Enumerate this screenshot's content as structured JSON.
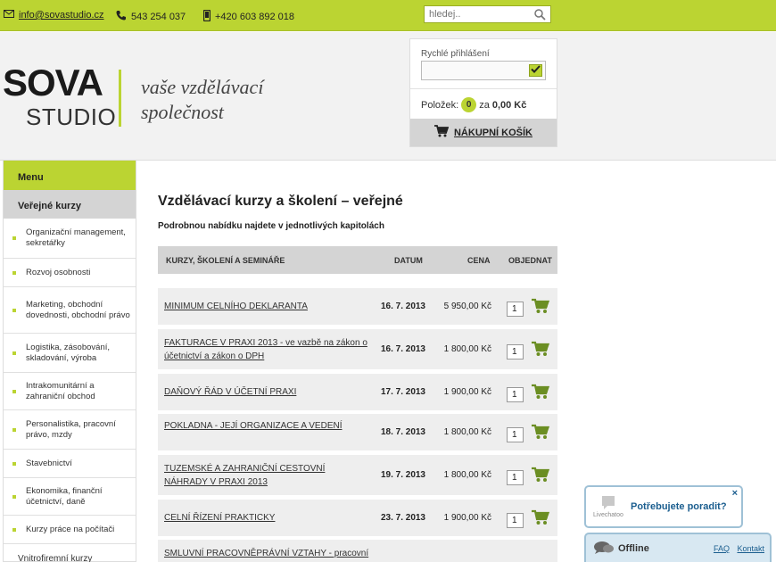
{
  "topbar": {
    "email": "info@sovastudio.cz",
    "phone": "543 254 037",
    "mobile": "+420 603 892 018",
    "search_placeholder": "hledej.."
  },
  "header": {
    "logo_main": "SOVA",
    "logo_sub": "STUDIO",
    "tagline_1": "vaše vzdělávací",
    "tagline_2": "společnost",
    "login_label": "Rychlé přihlášení",
    "items_label": "Položek:",
    "items_count": "0",
    "items_for": "za",
    "items_total": "0,00 Kč",
    "cart_label": "NÁKUPNÍ KOŠÍK"
  },
  "sidebar": {
    "menu_label": "Menu",
    "category": "Veřejné kurzy",
    "items": [
      "Organizační management, sekretářky",
      "Rozvoj osobnosti",
      "Marketing, obchodní dovednosti, obchodní právo",
      "Logistika, zásobování, skladování, výroba",
      "Intrakomunitární a zahraniční obchod",
      "Personalistika, pracovní právo, mzdy",
      "Stavebnictví",
      "Ekonomika, finanční účetnictví, daně",
      "Kurzy práce na počítači"
    ],
    "bottom_item": "Vnitrofiremní kurzy"
  },
  "main": {
    "title": "Vzdělávací kurzy a školení – veřejné",
    "subtitle": "Podrobnou nabídku najdete v jednotlivých kapitolách",
    "columns": {
      "name": "KURZY, ŠKOLENÍ A SEMINÁŘE",
      "date": "DATUM",
      "price": "CENA",
      "order": "OBJEDNAT"
    },
    "rows": [
      {
        "name": "MINIMUM CELNÍHO DEKLARANTA",
        "date": "16. 7. 2013",
        "price": "5 950,00 Kč",
        "qty": "1"
      },
      {
        "name": "FAKTURACE V PRAXI 2013 - ve vazbě na zákon o účetnictví a zákon o DPH",
        "date": "16. 7. 2013",
        "price": "1 800,00 Kč",
        "qty": "1"
      },
      {
        "name": "DAŇOVÝ ŘÁD V ÚČETNÍ PRAXI",
        "date": "17. 7. 2013",
        "price": "1 900,00 Kč",
        "qty": "1"
      },
      {
        "name": "POKLADNA - JEJÍ ORGANIZACE A VEDENÍ",
        "date": "18. 7. 2013",
        "price": "1 800,00 Kč",
        "qty": "1"
      },
      {
        "name": "TUZEMSKÉ A ZAHRANIČNÍ CESTOVNÍ NÁHRADY V PRAXI 2013",
        "date": "19. 7. 2013",
        "price": "1 800,00 Kč",
        "qty": "1"
      },
      {
        "name": "CELNÍ ŘÍZENÍ PRAKTICKY",
        "date": "23. 7. 2013",
        "price": "1 900,00 Kč",
        "qty": "1"
      },
      {
        "name": "SMLUVNÍ PRACOVNĚPRÁVNÍ VZTAHY - pracovní",
        "date": "",
        "price": "",
        "qty": ""
      }
    ]
  },
  "chat": {
    "question": "Potřebujete poradit?",
    "brand": "Livechatoo",
    "close": "×",
    "status": "Offline",
    "faq": "FAQ",
    "contact": "Kontakt"
  },
  "colors": {
    "accent": "#bbd432",
    "cart_icon": "#6b8e23",
    "chat_border": "#9fc1d6"
  }
}
